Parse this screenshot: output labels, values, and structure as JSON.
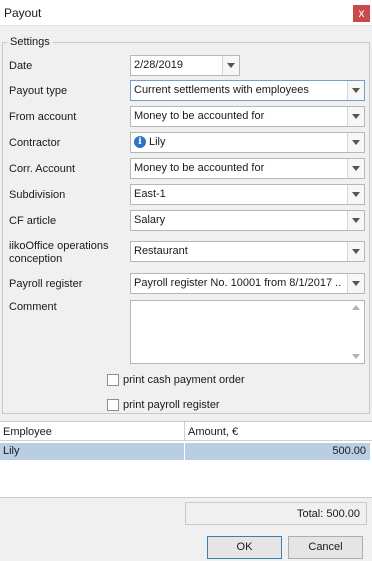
{
  "window": {
    "title": "Payout",
    "close_glyph": "x"
  },
  "settings": {
    "group_title": "Settings",
    "date": {
      "label": "Date",
      "value": "2/28/2019"
    },
    "payout_type": {
      "label": "Payout type",
      "value": "Current settlements with employees"
    },
    "from_account": {
      "label": "From account",
      "value": "Money to be accounted for"
    },
    "contractor": {
      "label": "Contractor",
      "value": "Lily",
      "icon": "info-icon"
    },
    "corr_account": {
      "label": "Corr. Account",
      "value": "Money to be accounted for"
    },
    "subdivision": {
      "label": "Subdivision",
      "value": "East-1"
    },
    "cf_article": {
      "label": "CF article",
      "value": "Salary"
    },
    "operations_conception": {
      "label_line1": "iikoOffice operations",
      "label_line2": "conception",
      "value": "Restaurant"
    },
    "payroll_register": {
      "label": "Payroll register",
      "value": "Payroll register No. 10001 from 8/1/2017 ..."
    },
    "comment": {
      "label": "Comment",
      "value": ""
    },
    "print_cash_payment_order": {
      "label": "print cash payment order",
      "checked": false
    },
    "print_payroll_register": {
      "label": "print payroll register",
      "checked": false
    }
  },
  "grid": {
    "columns": [
      "Employee",
      "Amount, €"
    ],
    "rows": [
      {
        "employee": "Lily",
        "amount": "500.00"
      }
    ],
    "total": "Total: 500.00"
  },
  "buttons": {
    "ok": "OK",
    "cancel": "Cancel"
  },
  "colors": {
    "selected_row": "#b9cde3",
    "close_button": "#c94a4a",
    "info_icon": "#2b74c6"
  }
}
